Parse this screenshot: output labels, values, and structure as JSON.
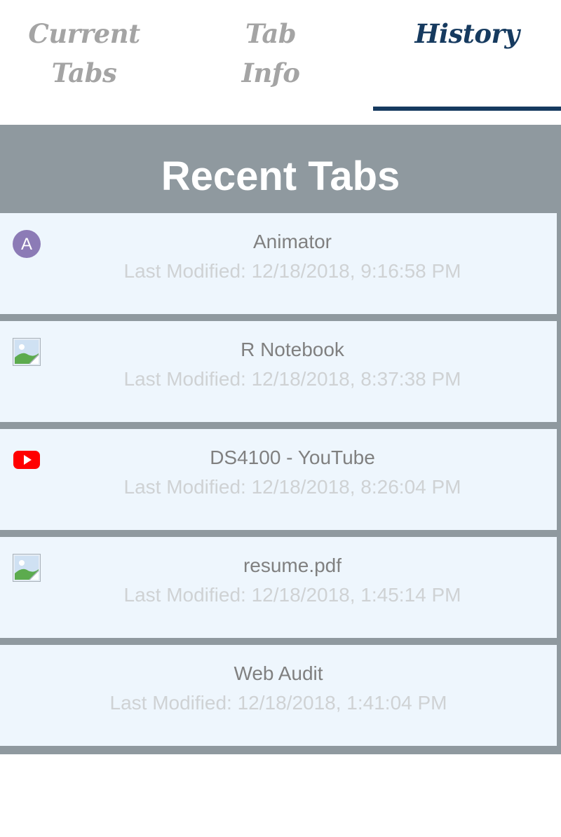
{
  "tabs": [
    {
      "label": "Current Tabs",
      "active": false
    },
    {
      "label": "Tab Info",
      "active": false
    },
    {
      "label": "History",
      "active": true
    }
  ],
  "colors": {
    "active_tab": "#163a5f",
    "inactive_tab": "#a4a4a4",
    "panel_bg": "#8f999f",
    "row_bg": "#eef6fd",
    "title_text": "#808080",
    "modified_text": "#cfd2d4"
  },
  "panel": {
    "title": "Recent Tabs"
  },
  "recent": [
    {
      "title": "Animator",
      "modified": "Last Modified: 12/18/2018, 9:16:58 PM",
      "icon": "letter-a-icon",
      "icon_letter": "A"
    },
    {
      "title": "R Notebook",
      "modified": "Last Modified: 12/18/2018, 8:37:38 PM",
      "icon": "broken-image-icon"
    },
    {
      "title": "DS4100 - YouTube",
      "modified": "Last Modified: 12/18/2018, 8:26:04 PM",
      "icon": "youtube-icon"
    },
    {
      "title": "resume.pdf",
      "modified": "Last Modified: 12/18/2018, 1:45:14 PM",
      "icon": "broken-image-icon"
    },
    {
      "title": "Web Audit",
      "modified": "Last Modified: 12/18/2018, 1:41:04 PM",
      "icon": "none"
    }
  ]
}
